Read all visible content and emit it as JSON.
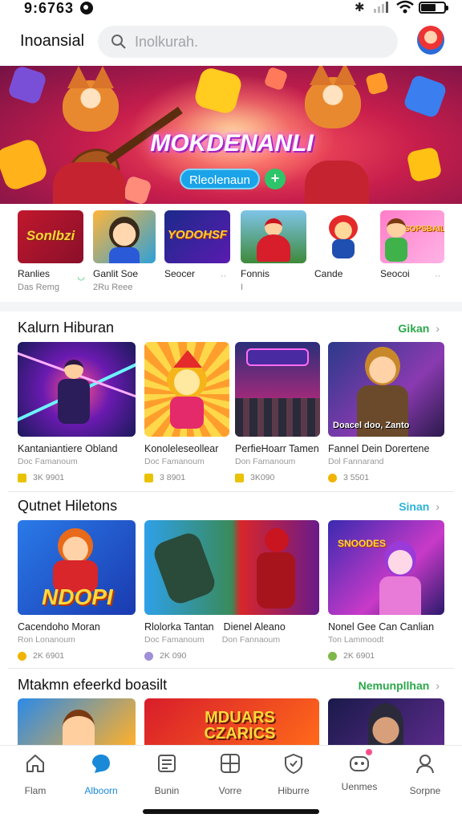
{
  "status": {
    "time": "9:6763"
  },
  "header": {
    "brand": "Inoansial",
    "search_placeholder": "Inolkurah."
  },
  "hero": {
    "title": "MOKDENANLI",
    "cta_label": "Rleolenaun",
    "play_glyph": "+"
  },
  "categories": [
    {
      "label": "Ranlies",
      "sub": "Das Remg",
      "mark": "◡"
    },
    {
      "label": "Ganlit Soe",
      "sub": "2Ru Reee",
      "mark": ""
    },
    {
      "label": "Seocer",
      "sub": "",
      "mark": "··"
    },
    {
      "label": "Fonnis",
      "sub": "I",
      "mark": ""
    },
    {
      "label": "Cande",
      "sub": "",
      "mark": ""
    },
    {
      "label": "Seocoi",
      "sub": "",
      "mark": "··"
    }
  ],
  "sections": [
    {
      "title": "Kalurn Hiburan",
      "more": "Gikan",
      "more_color": "#2aa84a",
      "cards": [
        {
          "title": "Kantaniantiere Obland",
          "sub": "Doc Famanoum",
          "rating": "3K 9901"
        },
        {
          "title": "Konoleleseollear",
          "sub": "Doc Famanoum",
          "rating": "3 8901"
        },
        {
          "title": "PerfieHoarr Tamen",
          "sub": "Don Famanoum",
          "rating": "3K090"
        },
        {
          "title": "Fannel Dein Dorertene",
          "sub": "Dol Fannarand",
          "rating": "3 5501"
        }
      ]
    },
    {
      "title": "Qutnet Hiletons",
      "more": "Sinan",
      "more_color": "#2bb3d9",
      "cards": [
        {
          "title": "Cacendoho Moran",
          "sub": "Ron Lonanoum",
          "rating": "2K 6901"
        },
        {
          "title": "Rlolorka Tantan",
          "sub": "Doc Famanoum",
          "rating": "2K 090"
        },
        {
          "title": "Dienel Aleano",
          "sub": "Don Fannaoum",
          "rating": ""
        },
        {
          "title": "Nonel Gee Can Canlian",
          "sub": "Ton Lammoodt",
          "rating": "2K 6901"
        }
      ]
    },
    {
      "title": "Mtakmn efeerkd boasilt",
      "more": "Nemunpllhan",
      "more_color": "#2aa84a"
    }
  ],
  "hero_image_texts": {
    "card1": "NDOPI",
    "card4": "SNOODES",
    "game2": "Doacel doo, Zanto",
    "sec3_2": "MDUARS CZARICS",
    "cat1": "Sonlbzi",
    "cat3": "YODOHSF",
    "cat6": "SOPSBAIL"
  },
  "nav": [
    {
      "label": "Flam"
    },
    {
      "label": "Alboorn"
    },
    {
      "label": "Bunin"
    },
    {
      "label": "Vorre"
    },
    {
      "label": "Hiburre"
    },
    {
      "label": "Uenmes"
    },
    {
      "label": "Sorpne"
    }
  ],
  "colors": {
    "accent": "#1a8ad8",
    "green": "#2aa84a",
    "hero_bg": "#c81e4c"
  }
}
